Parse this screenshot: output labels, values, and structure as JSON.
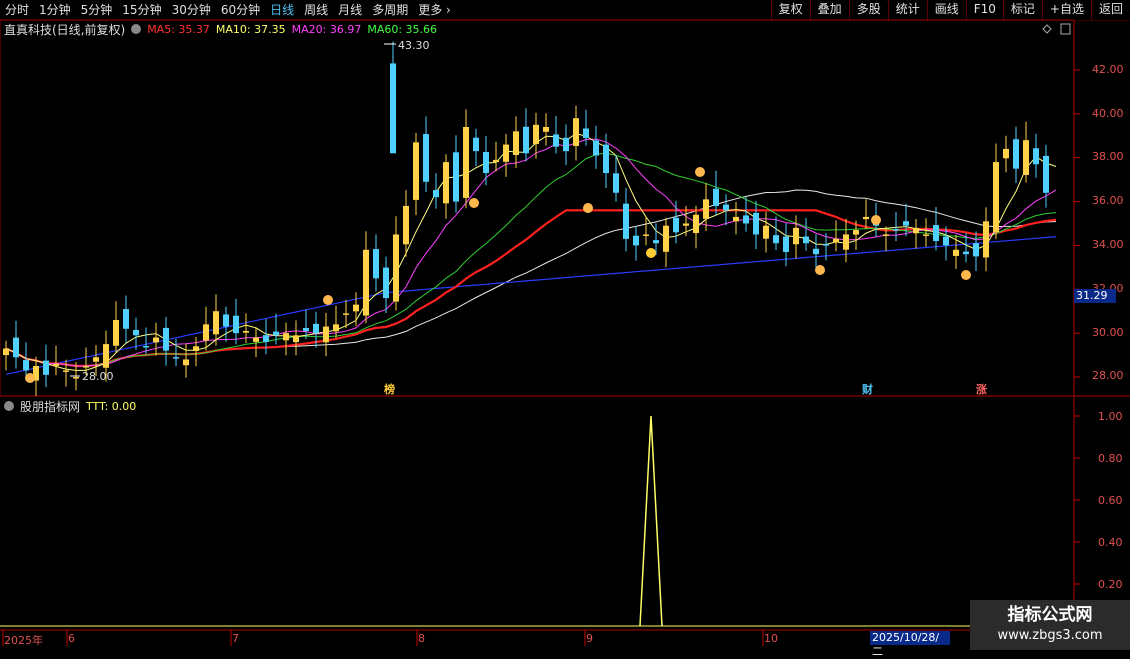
{
  "toolbar": {
    "tabs": [
      "分时",
      "1分钟",
      "5分钟",
      "15分钟",
      "30分钟",
      "60分钟",
      "日线",
      "周线",
      "月线",
      "多周期",
      "更多"
    ],
    "active_tab": "日线",
    "right_buttons": [
      "复权",
      "叠加",
      "多股",
      "统计",
      "画线",
      "F10",
      "标记",
      "+自选",
      "返回"
    ]
  },
  "main_chart": {
    "title": "直真科技(日线,前复权)",
    "ma": [
      {
        "label": "MA5: 35.37",
        "color": "#ff3030"
      },
      {
        "label": "MA10: 37.35",
        "color": "#ffff66"
      },
      {
        "label": "MA20: 36.97",
        "color": "#ff40ff"
      },
      {
        "label": "MA60: 35.66",
        "color": "#40ff40"
      }
    ],
    "price_axis": [
      "42.00",
      "40.00",
      "38.00",
      "36.00",
      "34.00",
      "32.00",
      "30.00",
      "28.00"
    ],
    "current_price": "31.29",
    "high_label": "43.30",
    "low_label": "28.00",
    "event_tags": [
      "榜",
      "财",
      "涨"
    ]
  },
  "indicator": {
    "name": "股朋指标网",
    "value_label": "TTT: 0.00",
    "axis": [
      "1.00",
      "0.80",
      "0.60",
      "0.40",
      "0.20"
    ]
  },
  "date_axis": {
    "labels": [
      "2025年",
      "6",
      "7",
      "8",
      "9",
      "10"
    ],
    "cursor_date": "2025/10/28/二"
  },
  "watermark": {
    "title": "指标公式网",
    "url": "www.zbgs3.com"
  },
  "colors": {
    "up": "#ffd24a",
    "down": "#4fd0ff",
    "axis": "#c00000",
    "ma60": "#1e2fff",
    "ma_red": "#ff2020"
  }
}
